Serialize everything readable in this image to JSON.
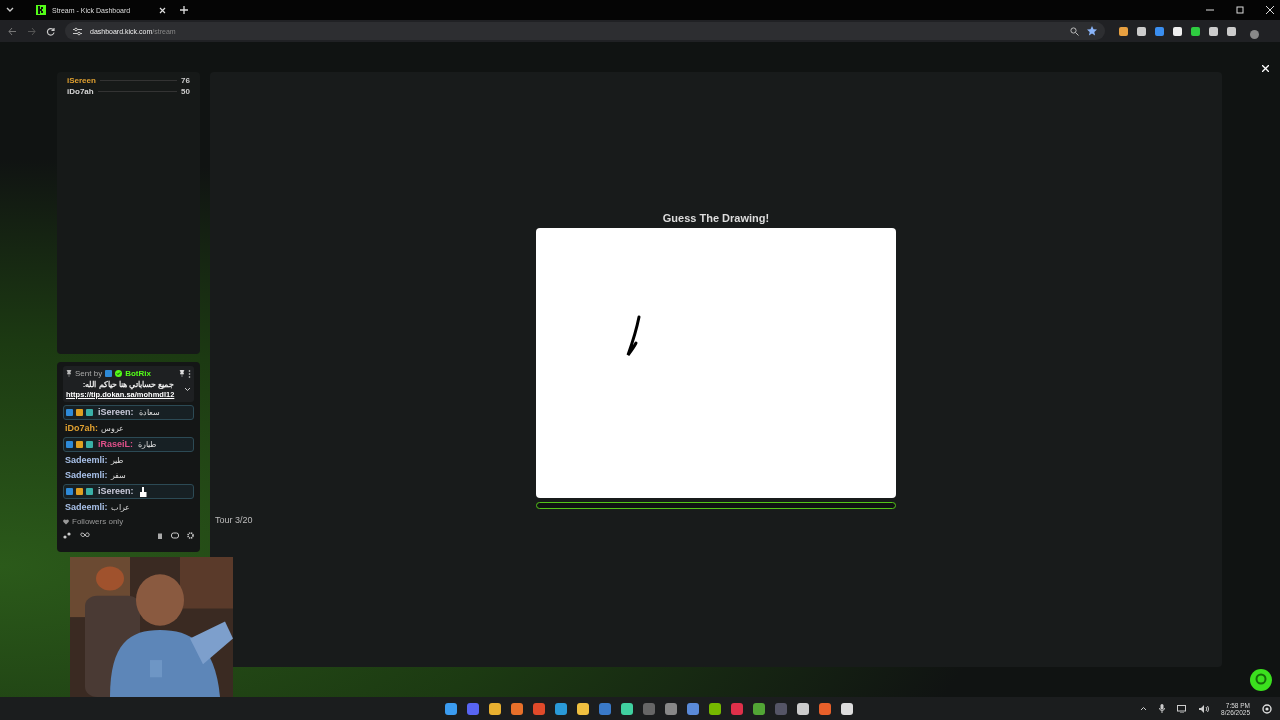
{
  "browser": {
    "tab_title": "Stream - Kick Dashboard",
    "url_host": "dashboard.kick.com",
    "url_path": "/stream"
  },
  "leaderboard": [
    {
      "name": "iSereen",
      "score": "76",
      "color": "#e0a030"
    },
    {
      "name": "iDo7ah",
      "score": "50",
      "color": "#d8d8d8"
    }
  ],
  "chat": {
    "pinned": {
      "sent_by": "Sent by",
      "bot": "BotRix",
      "message": "جميع حساباتي هنا حياكم الله:",
      "link": "https://tip.dokan.sa/mohmdl12"
    },
    "messages": [
      {
        "kind": "badged",
        "user": "iSereen:",
        "text": "سعادة",
        "color": "#c8c8d8"
      },
      {
        "kind": "plain",
        "user": "iDo7ah:",
        "text": "عروس",
        "color": "#e0a030"
      },
      {
        "kind": "badged",
        "user": "iRaseiL:",
        "text": "طيارة",
        "color": "#e0508a"
      },
      {
        "kind": "plain",
        "user": "Sadeemli:",
        "text": "طير",
        "color": "#a8c0e8"
      },
      {
        "kind": "plain",
        "user": "Sadeemli:",
        "text": "سفر",
        "color": "#a8c0e8"
      },
      {
        "kind": "badged",
        "user": "iSereen:",
        "color": "#c8c8d8"
      },
      {
        "kind": "plain",
        "user": "Sadeemli:",
        "text": "عراب",
        "color": "#a8c0e8"
      }
    ],
    "mode": "Followers only"
  },
  "game": {
    "title": "Guess The Drawing!",
    "progress": {
      "level": 0.0
    },
    "round": "Tour 3/20"
  },
  "clock": {
    "time": "7:58 PM",
    "date": "8/26/2025"
  }
}
